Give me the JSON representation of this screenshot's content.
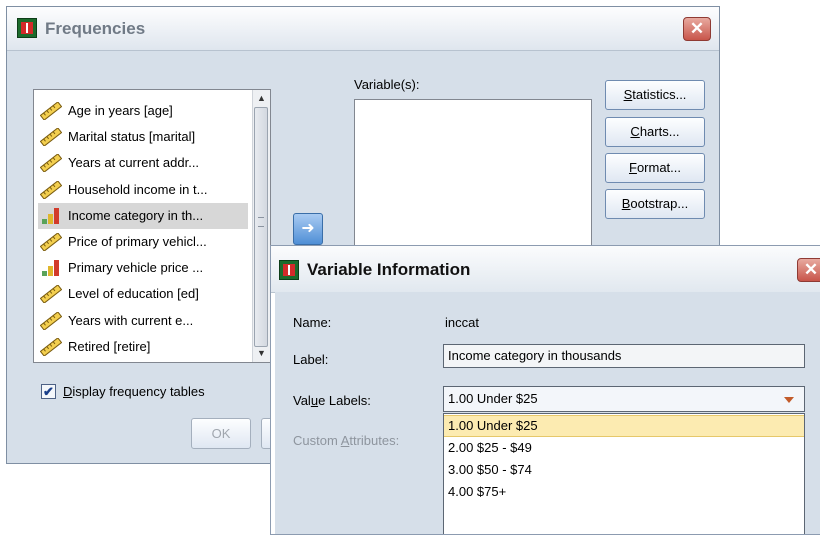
{
  "frequencies": {
    "title": "Frequencies",
    "variables_label": "Variable(s):",
    "variable_list": [
      {
        "label": "Age in years [age]",
        "kind": "scale"
      },
      {
        "label": "Marital status [marital]",
        "kind": "scale"
      },
      {
        "label": "Years at current addr...",
        "kind": "scale"
      },
      {
        "label": "Household income in t...",
        "kind": "scale"
      },
      {
        "label": "Income category in th...",
        "kind": "ordinal",
        "selected": true
      },
      {
        "label": "Price of primary vehicl...",
        "kind": "scale"
      },
      {
        "label": "Primary vehicle price ...",
        "kind": "ordinal"
      },
      {
        "label": "Level of education [ed]",
        "kind": "scale"
      },
      {
        "label": "Years with current e...",
        "kind": "scale"
      },
      {
        "label": "Retired [retire]",
        "kind": "scale"
      }
    ],
    "buttons": {
      "statistics": {
        "mnemonic": "S",
        "rest": "tatistics..."
      },
      "charts": {
        "mnemonic": "C",
        "rest": "harts..."
      },
      "format": {
        "mnemonic": "F",
        "rest": "ormat..."
      },
      "bootstrap": {
        "mnemonic": "B",
        "rest": "ootstrap..."
      },
      "ok": "OK"
    },
    "display_tables": {
      "mnemonic": "D",
      "rest": "isplay frequency tables",
      "checked": true
    },
    "move_icon": "arrow-right-icon"
  },
  "variable_info": {
    "title": "Variable Information",
    "name_label": "Name:",
    "name_value": "inccat",
    "label_label": "Label:",
    "label_value": "Income category in thousands",
    "value_labels_label_pre": "Val",
    "value_labels_mnemonic": "u",
    "value_labels_label_post": "e Labels:",
    "value_labels_selected": "1.00  Under $25",
    "value_labels_options": [
      "1.00  Under $25",
      "2.00  $25 - $49",
      "3.00  $50 - $74",
      "4.00  $75+"
    ],
    "custom_attributes_pre": "Custom ",
    "custom_attributes_mnemonic": "A",
    "custom_attributes_post": "ttributes:"
  },
  "colors": {
    "dialog_bg": "#d6dfe9",
    "selected_option": "#fcebb1",
    "close_button": "#c8554a",
    "move_button": "#4f8fd6"
  }
}
